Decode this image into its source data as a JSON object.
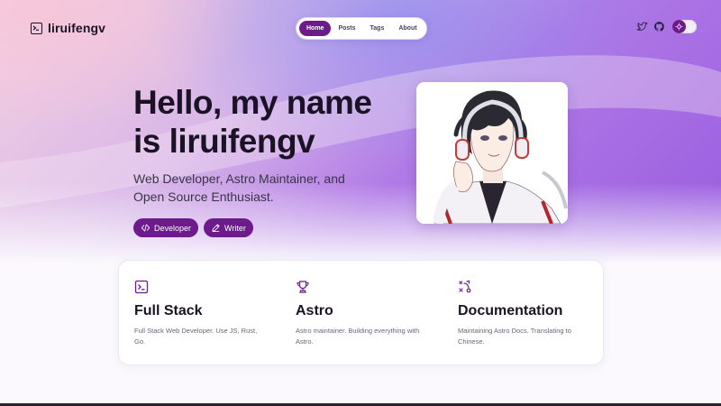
{
  "brand": {
    "name": "liruifengv",
    "icon": "terminal-icon"
  },
  "nav": {
    "items": [
      {
        "label": "Home",
        "active": true
      },
      {
        "label": "Posts",
        "active": false
      },
      {
        "label": "Tags",
        "active": false
      },
      {
        "label": "About",
        "active": false
      }
    ]
  },
  "header_icons": [
    "twitter-icon",
    "github-icon"
  ],
  "theme_toggle": {
    "icon": "sun-icon"
  },
  "hero": {
    "title": "Hello, my name is liruifengv",
    "subtitle": "Web Developer, Astro Maintainer, and Open Source Enthusiast.",
    "tags": [
      {
        "label": "Developer",
        "icon": "code-icon"
      },
      {
        "label": "Writer",
        "icon": "pencil-icon"
      }
    ]
  },
  "features": [
    {
      "icon": "terminal-icon",
      "title": "Full Stack",
      "description": "Full Stack Web Developer. Use JS, Rust, Go."
    },
    {
      "icon": "trophy-icon",
      "title": "Astro",
      "description": "Astro maintainer. Building everything with Astro."
    },
    {
      "icon": "strategy-icon",
      "title": "Documentation",
      "description": "Maintaining Astro Docs. Translating to Chinese."
    }
  ],
  "colors": {
    "accent": "#6d1a8c",
    "text": "#1b1325",
    "muted": "#6b6578"
  }
}
